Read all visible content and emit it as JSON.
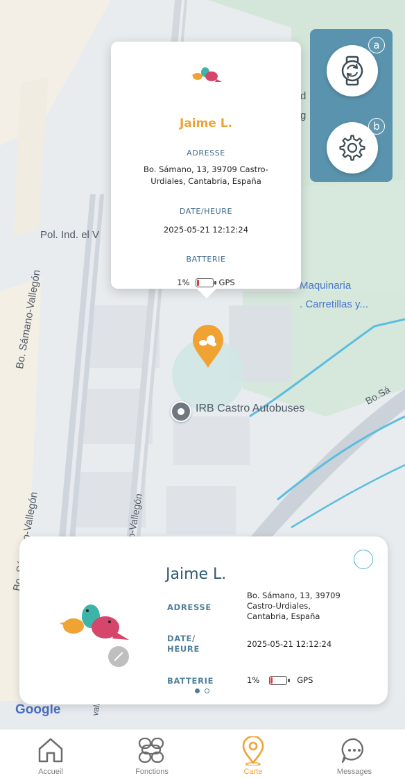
{
  "map": {
    "labels": {
      "pol_ind": "Pol. Ind. el V",
      "street_v1": "Bo. Sámano-Vallegón",
      "street_v2": "Bo. Sámano-Vallegón",
      "street_v3": "ano-Vallegón",
      "street_bottom_left": "Bo S",
      "street_right": "Bo.Sá",
      "partial_d": "d",
      "partial_g": "g",
      "street_bottom": "valle",
      "street_bottom2": "S",
      "poi_maquinaria": "Maquinaria",
      "poi_carretillas": ". Carretillas y...",
      "poi_bus": "IRB Castro Autobuses",
      "google": "Google"
    }
  },
  "popup": {
    "name": "Jaime L.",
    "address_label": "ADRESSE",
    "address_line1": "Bo. Sámano, 13, 39709 Castro-",
    "address_line2": "Urdiales, Cantabria, España",
    "datetime_label": "DATE/HEURE",
    "datetime": "2025-05-21 12:12:24",
    "battery_label": "BATTERIE",
    "battery_value": "1%",
    "battery_level": 0.01,
    "gps_label": "GPS"
  },
  "side_panel": {
    "watch_tag": "a",
    "settings_tag": "b"
  },
  "card": {
    "name": "Jaime L.",
    "address_label": "ADRESSE",
    "address_line1": "Bo. Sámano, 13, 39709",
    "address_line2": "Castro-Urdiales,",
    "address_line3": "Cantabria, España",
    "date_label_1": "DATE/",
    "date_label_2": "HEURE",
    "datetime": "2025-05-21 12:12:24",
    "battery_label": "BATTERIE",
    "battery_value": "1%",
    "gps_label": "GPS",
    "page_index": 0,
    "page_count": 2
  },
  "nav": {
    "items": [
      {
        "label": "Accueil",
        "active": false
      },
      {
        "label": "Fonctions",
        "active": false
      },
      {
        "label": "Carte",
        "active": true
      },
      {
        "label": "Messages",
        "active": false
      }
    ]
  },
  "colors": {
    "accent": "#f0a233",
    "panel": "#5993ae",
    "label": "#4f7f98"
  }
}
